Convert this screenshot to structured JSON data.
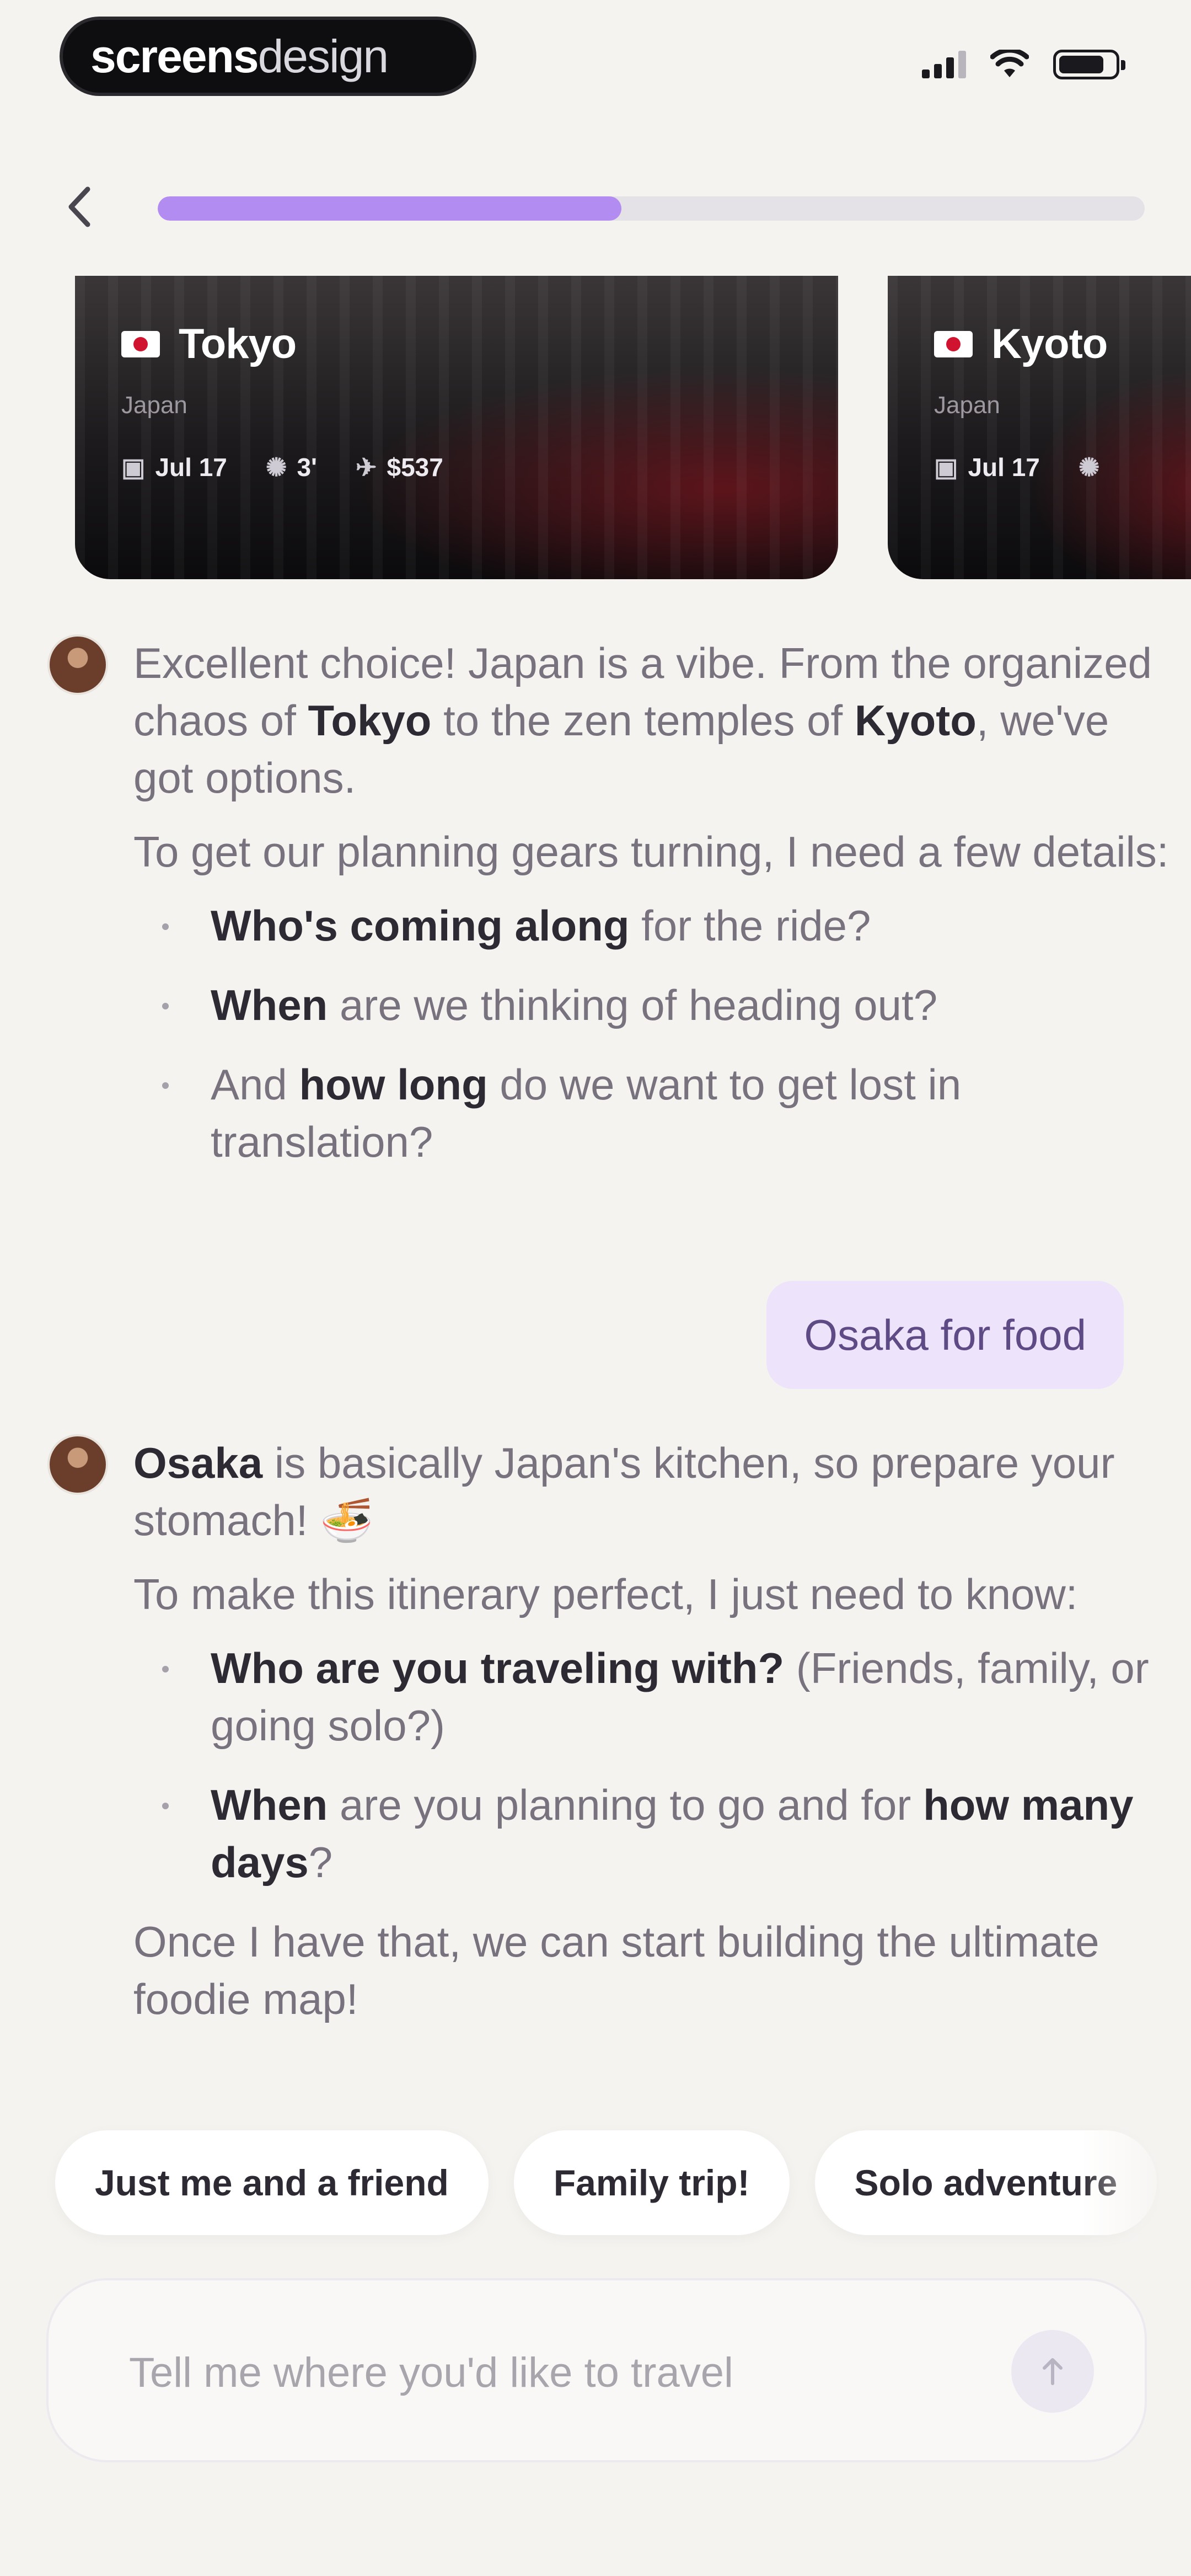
{
  "status_bar": {
    "brand_bold": "screens",
    "brand_light": "design"
  },
  "header": {
    "progress": 0.47
  },
  "cards": [
    {
      "city": "Tokyo",
      "country": "Japan",
      "date": "Jul 17",
      "people": "3'",
      "price": "$537"
    },
    {
      "city": "Kyoto",
      "country": "Japan",
      "date": "Jul 17"
    }
  ],
  "assistant_1": {
    "p1": [
      "Excellent choice! Japan is a vibe. From the organized chaos of ",
      "Tokyo",
      " to the zen temples of ",
      "Kyoto",
      ", we've got options."
    ],
    "p2": "To get our planning gears turning, I need a few details:",
    "bullets": [
      [
        "Who's coming along",
        " for the ride?"
      ],
      [
        "When",
        " are we thinking of heading out?"
      ],
      [
        "And ",
        "how long",
        " do we want to get lost in translation?"
      ]
    ]
  },
  "user_message": "Osaka for food",
  "assistant_2": {
    "p1": [
      "Osaka",
      " is basically Japan's kitchen, so prepare your stomach! 🍜"
    ],
    "p2": "To make this itinerary perfect, I just need to know:",
    "bullets": [
      [
        "Who are you traveling with?",
        " (Friends, family, or going solo?)"
      ],
      [
        "When",
        " are you planning to go and for ",
        "how many days",
        "?"
      ]
    ],
    "p3": "Once I have that, we can start building the ultimate foodie map!"
  },
  "chips": [
    "Just me and a friend",
    "Family trip!",
    "Solo adventure"
  ],
  "composer": {
    "placeholder": "Tell me where you'd like to travel"
  }
}
